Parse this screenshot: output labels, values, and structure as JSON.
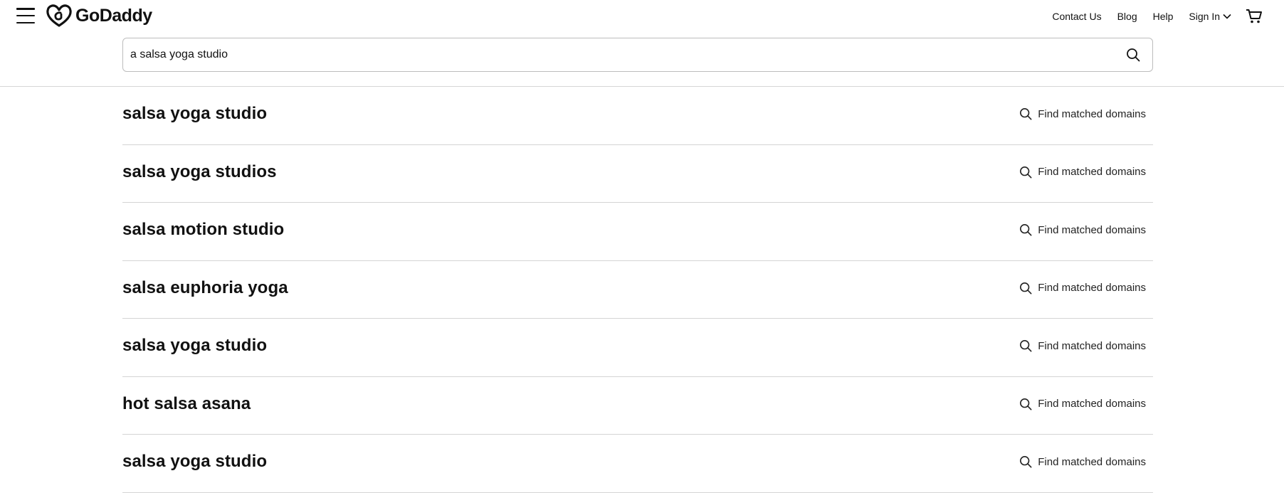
{
  "header": {
    "logo_text": "GoDaddy",
    "nav": {
      "contact": "Contact Us",
      "blog": "Blog",
      "help": "Help",
      "sign_in": "Sign In"
    }
  },
  "search": {
    "value": "a salsa yoga studio"
  },
  "results": [
    {
      "name": "salsa yoga studio",
      "action": "Find matched domains"
    },
    {
      "name": "salsa yoga studios",
      "action": "Find matched domains"
    },
    {
      "name": "salsa motion studio",
      "action": "Find matched domains"
    },
    {
      "name": "salsa euphoria yoga",
      "action": "Find matched domains"
    },
    {
      "name": "salsa yoga studio",
      "action": "Find matched domains"
    },
    {
      "name": "hot salsa asana",
      "action": "Find matched domains"
    },
    {
      "name": "salsa yoga studio",
      "action": "Find matched domains"
    }
  ],
  "icons": {
    "menu": "hamburger-menu-icon",
    "logo": "godaddy-heart-logo-icon",
    "chevron": "chevron-down-icon",
    "cart": "shopping-cart-icon",
    "search": "search-icon"
  }
}
